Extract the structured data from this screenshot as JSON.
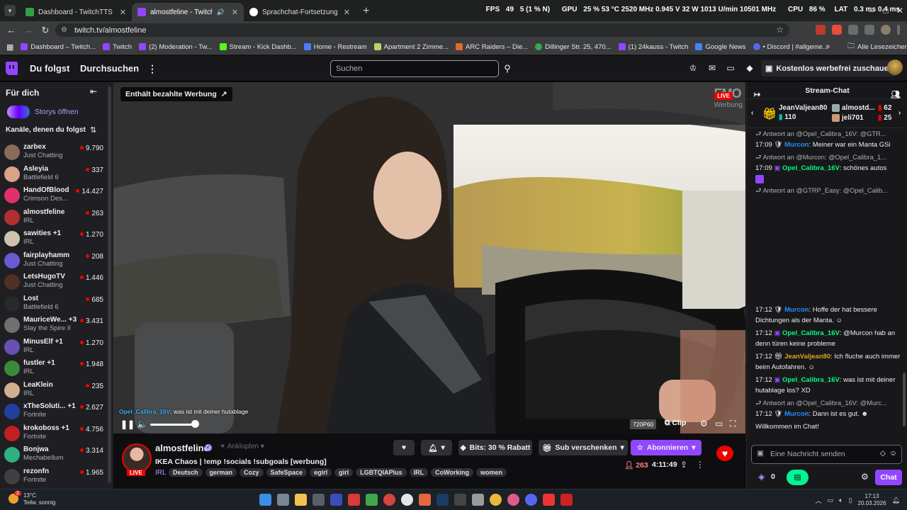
{
  "browser": {
    "tabs": [
      {
        "title": "Dashboard - TwitchTTS",
        "color": "#2ea043",
        "active": false
      },
      {
        "title": "almostfeline - Twitch",
        "color": "#9147ff",
        "active": true
      },
      {
        "title": "Sprachchat-Fortsetzung und K",
        "color": "#ffffff",
        "active": false
      }
    ],
    "hw": {
      "fps": "FPS",
      "fps_val": "49",
      "frames": "5 (1 % N)",
      "gpu": "GPU",
      "gpu_val": "25 % 53 °C 2520 MHz 0.945 V 32 W 1013 U/min 10501 MHz",
      "cpu": "CPU",
      "cpu_val": "86 %",
      "lat": "LAT",
      "lat_val": "0.3 ms 0.4 ms"
    },
    "url": "twitch.tv/almostfeline",
    "bookmarks": [
      {
        "label": "Dashboard – Twitch...",
        "color": "#9147ff"
      },
      {
        "label": "Twitch",
        "color": "#9147ff"
      },
      {
        "label": "(2) Moderation - Tw...",
        "color": "#9147ff"
      },
      {
        "label": "Stream - Kick Dashb...",
        "color": "#53fc18"
      },
      {
        "label": "Home - Restream",
        "color": "#4a7cff"
      },
      {
        "label": "Apartment 2 Zimme...",
        "color": "#b7d36b"
      },
      {
        "label": "ARC Raiders – Die...",
        "color": "#e06b2a"
      },
      {
        "label": "Dillinger Str. 25, 470...",
        "color": "#34a853"
      },
      {
        "label": "(1) 24kauss - Twitch",
        "color": "#9147ff"
      },
      {
        "label": "Google News",
        "color": "#4285f4"
      },
      {
        "label": "• Discord | #allgeme...",
        "color": "#5865f2"
      }
    ],
    "all_bookmarks": "Alle Lesezeichen"
  },
  "header": {
    "following": "Du folgst",
    "browse": "Durchsuchen",
    "search_placeholder": "Suchen",
    "adfree": "Kostenlos werbefrei zuschauen"
  },
  "sidebar": {
    "for_you": "Für dich",
    "stories": "Storys öffnen",
    "followed_heading": "Kanäle, denen du folgst",
    "channels": [
      {
        "name": "zarbex",
        "game": "Just Chatting",
        "viewers": "9.790",
        "color": "#8a6a5a"
      },
      {
        "name": "Asleyia",
        "game": "Battlefield 6",
        "viewers": "337",
        "color": "#d9a38a"
      },
      {
        "name": "HandOfBlood",
        "game": "Crimson Des...",
        "viewers": "14.427",
        "color": "#e0306a"
      },
      {
        "name": "almostfeline",
        "game": "IRL",
        "viewers": "263",
        "color": "#b03030"
      },
      {
        "name": "sawities +1",
        "game": "IRL",
        "viewers": "1.270",
        "color": "#cfc3b0"
      },
      {
        "name": "fairplayhamm",
        "game": "Just Chatting",
        "viewers": "208",
        "color": "#6a5ad0"
      },
      {
        "name": "LetsHugoTV",
        "game": "Just Chatting",
        "viewers": "1.446",
        "color": "#503020"
      },
      {
        "name": "Lost",
        "game": "Battlefield 6",
        "viewers": "685",
        "color": "#2a2a2a"
      },
      {
        "name": "MauriceWe... +3",
        "game": "Slay the Spire II",
        "viewers": "3.431",
        "color": "#707070"
      },
      {
        "name": "MinusElf +1",
        "game": "IRL",
        "viewers": "1.270",
        "color": "#6a50b0"
      },
      {
        "name": "fustler +1",
        "game": "IRL",
        "viewers": "1.948",
        "color": "#3a8a3a"
      },
      {
        "name": "LeaKlein",
        "game": "IRL",
        "viewers": "235",
        "color": "#d0b090"
      },
      {
        "name": "xTheSoluti... +1",
        "game": "Fortnite",
        "viewers": "2.627",
        "color": "#2040a0"
      },
      {
        "name": "krokoboss +1",
        "game": "Fortnite",
        "viewers": "4.756",
        "color": "#c02020"
      },
      {
        "name": "Bonjwa",
        "game": "Mechabellum",
        "viewers": "3.314",
        "color": "#30b080"
      },
      {
        "name": "rezonfn",
        "game": "Fortnite",
        "viewers": "1.965",
        "color": "#404040"
      }
    ]
  },
  "player": {
    "ad_badge": "Enthält bezahlte Werbung",
    "watermark": "EMO",
    "watermark_sub": "Werbung",
    "live": "LIVE",
    "overlay_chat_user": "Opel_Calibra_16V",
    "overlay_chat_text": "was ist mit deiner hutablage",
    "quality": "720P60",
    "clip": "Clip"
  },
  "stream": {
    "name": "almostfeline",
    "pin": "Anklopfen",
    "title": "IKEA Chaos | !emp !socials !subgoals [werbung]",
    "category": "IRL",
    "tags": [
      "Deutsch",
      "german",
      "Cozy",
      "SafeSpace",
      "egirl",
      "girl",
      "LGBTQIAPlus",
      "IRL",
      "CoWorking",
      "women"
    ],
    "bits": "Bits: 30 % Rabatt",
    "gift": "Sub verschenken",
    "subscribe": "Abonnieren",
    "viewers": "263",
    "uptime": "4:11:49",
    "live": "LIVE"
  },
  "chat": {
    "title": "Stream-Chat",
    "leader": [
      {
        "name": "JeanValjean80",
        "count": "110"
      },
      {
        "name": "almostd...",
        "count": "62"
      },
      {
        "name": "jeli701",
        "count": "25"
      }
    ],
    "messages": [
      {
        "reply": "Antwort an @Opel_Calibra_16V: @GTR...",
        "time": "17:09",
        "user": "Murcon",
        "color": "#1e90ff",
        "text": "Meiner war ein Manta GSi"
      },
      {
        "reply": "Antwort an @Murcon: @Opel_Calibra_1...",
        "time": "17:09",
        "user": "Opel_Calibra_16V",
        "color": "#00ff7f",
        "text": "schönes autos"
      },
      {
        "reply": "Antwort an @GTRP_Easy: @Opel_Calib...",
        "time": "",
        "user": "",
        "color": "",
        "text": ""
      },
      {
        "reply": "",
        "time": "17:12",
        "user": "Murcon",
        "color": "#1e90ff",
        "text": "Hoffe der hat bessere Dichtungen als der Manta."
      },
      {
        "reply": "",
        "time": "17:12",
        "user": "Opel_Calibra_16V",
        "color": "#00ff7f",
        "text": "@Murcon hab an denn türen keine probleme"
      },
      {
        "reply": "",
        "time": "17:12",
        "user": "JeanValjean80",
        "color": "#daa520",
        "text": "Ich fluche auch immer beim Autofahren."
      },
      {
        "reply": "",
        "time": "17:12",
        "user": "Opel_Calibra_16V",
        "color": "#00ff7f",
        "text": "was ist mit deiner hutablage los? XD"
      },
      {
        "reply": "Antwort an @Opel_Calibra_16V: @Murc...",
        "time": "17:12",
        "user": "Murcon",
        "color": "#1e90ff",
        "text": "Dann ist es gut."
      }
    ],
    "welcome": "Willkommen im Chat!",
    "input_placeholder": "Eine Nachricht senden",
    "points": "0",
    "send": "Chat"
  },
  "taskbar": {
    "temp": "13°C",
    "weather": "Teilw. sonnig",
    "badge": "2",
    "time": "17:13",
    "date": "20.03.2026"
  }
}
